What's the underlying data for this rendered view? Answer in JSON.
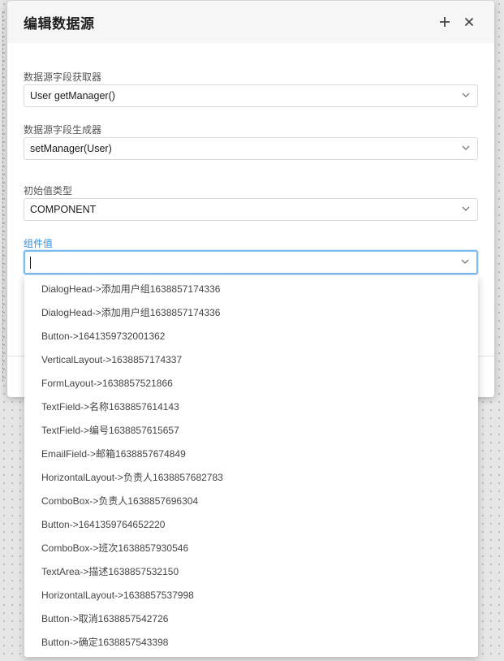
{
  "dialog": {
    "title": "编辑数据源",
    "add_icon": "plus-icon",
    "close_icon": "close-icon"
  },
  "fields": {
    "getter": {
      "label": "数据源字段获取器",
      "value": "User getManager()"
    },
    "setter": {
      "label": "数据源字段生成器",
      "value": "setManager(User)"
    },
    "initial_type": {
      "label": "初始值类型",
      "value": "COMPONENT"
    },
    "component": {
      "label": "组件值",
      "value": ""
    }
  },
  "dropdown": {
    "options": [
      "DialogHead->添加用户组1638857174336",
      "DialogHead->添加用户组1638857174336",
      "Button->1641359732001362",
      "VerticalLayout->1638857174337",
      "FormLayout->1638857521866",
      "TextField->名称1638857614143",
      "TextField->编号1638857615657",
      "EmailField->邮箱1638857674849",
      "HorizontalLayout->负责人1638857682783",
      "ComboBox->负责人1638857696304",
      "Button->1641359764652220",
      "ComboBox->班次1638857930546",
      "TextArea->描述1638857532150",
      "HorizontalLayout->1638857537998",
      "Button->取消1638857542726",
      "Button->确定1638857543398"
    ]
  },
  "colors": {
    "accent": "#2f8fd8",
    "focus_border": "#7dbcf0"
  }
}
